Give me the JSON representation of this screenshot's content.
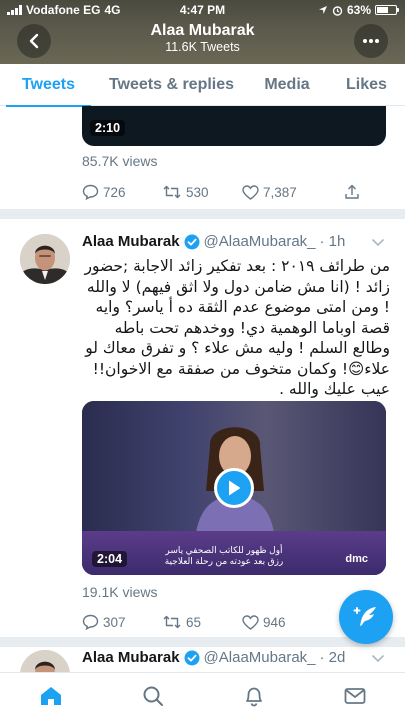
{
  "status_bar": {
    "carrier": "Vodafone EG",
    "network": "4G",
    "time": "4:47 PM",
    "battery": "63%",
    "battery_level": 0.63
  },
  "profile_header": {
    "title": "Alaa Mubarak",
    "subtitle": "11.6K Tweets"
  },
  "tabs": [
    {
      "label": "Tweets",
      "active": true
    },
    {
      "label": "Tweets & replies",
      "active": false
    },
    {
      "label": "Media",
      "active": false
    },
    {
      "label": "Likes",
      "active": false
    }
  ],
  "tweet_prev": {
    "video_duration": "2:10",
    "views": "85.7K views",
    "replies": "726",
    "retweets": "530",
    "likes": "7,387"
  },
  "tweet_main": {
    "name": "Alaa Mubarak",
    "handle": "@AlaaMubarak_",
    "time": "· 1h",
    "text": "من طرائف ٢٠١٩ : بعد تفكير زائد الاجابة ;حضور زائد ! (انا مش ضامن دول ولا اثق فيهم) لا والله ! ومن امتى موضوع عدم الثقة ده أ ياسر؟ وايه قصة اوباما الوهمية دي!  ووخدهم تحت باطه وطالع السلم ! وليه مش علاء ؟ و تفرق معاك لو علاء😊! وكمان متخوف من صفقة مع الاخوان!! عيب عليك والله .",
    "video_duration": "2:04",
    "video_logo": "dmc",
    "video_caption": "أول ظهور للكاتب الصحفي ياسر رزق بعد عودته من رحلة العلاجية",
    "views": "19.1K views",
    "replies": "307",
    "retweets": "65",
    "likes": "946"
  },
  "tweet_next": {
    "name": "Alaa Mubarak",
    "handle": "@AlaaMubarak_",
    "time": "· 2d"
  },
  "colors": {
    "accent": "#1da1f2",
    "secondary_text": "#657786",
    "primary_text": "#14171a",
    "separator": "#e6ecf0"
  },
  "icons": {
    "back": "chevron-left-icon",
    "more": "more-dots-icon",
    "reply": "reply-icon",
    "retweet": "retweet-icon",
    "like": "heart-icon",
    "share": "share-icon",
    "compose": "compose-tweet-icon",
    "home": "home-icon",
    "search": "search-icon",
    "notifications": "bell-icon",
    "messages": "mail-icon"
  }
}
